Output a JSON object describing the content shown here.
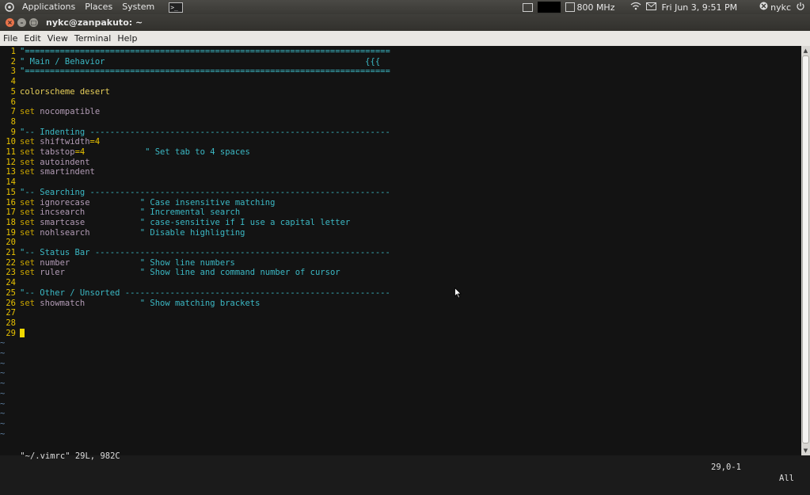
{
  "panel": {
    "menus": [
      "Applications",
      "Places",
      "System"
    ],
    "cpu_freq": "800 MHz",
    "datetime": "Fri Jun  3,  9:51 PM",
    "user": "nykc"
  },
  "window": {
    "title": "nykc@zanpakuto: ~"
  },
  "menubar": [
    "File",
    "Edit",
    "View",
    "Terminal",
    "Help"
  ],
  "editor": {
    "lines": [
      {
        "n": "1",
        "segs": [
          {
            "t": "\"=========================================================================",
            "c": "c-cmt"
          }
        ]
      },
      {
        "n": "2",
        "segs": [
          {
            "t": "\" Main / Behavior                                                    {{{",
            "c": "c-cmt"
          }
        ]
      },
      {
        "n": "3",
        "segs": [
          {
            "t": "\"=========================================================================",
            "c": "c-cmt"
          }
        ]
      },
      {
        "n": "4",
        "segs": []
      },
      {
        "n": "5",
        "segs": [
          {
            "t": "colorscheme desert",
            "c": "c-kw2"
          }
        ]
      },
      {
        "n": "6",
        "segs": []
      },
      {
        "n": "7",
        "segs": [
          {
            "t": "set ",
            "c": "c-kw"
          },
          {
            "t": "nocompatible",
            "c": "c-opt"
          }
        ]
      },
      {
        "n": "8",
        "segs": []
      },
      {
        "n": "9",
        "segs": [
          {
            "t": "\"-- Indenting ------------------------------------------------------------",
            "c": "c-cmt"
          }
        ]
      },
      {
        "n": "10",
        "segs": [
          {
            "t": "set ",
            "c": "c-kw"
          },
          {
            "t": "shiftwidth",
            "c": "c-opt"
          },
          {
            "t": "=4",
            "c": "c-val"
          }
        ]
      },
      {
        "n": "11",
        "segs": [
          {
            "t": "set ",
            "c": "c-kw"
          },
          {
            "t": "tabstop",
            "c": "c-opt"
          },
          {
            "t": "=4            ",
            "c": "c-val"
          },
          {
            "t": "\" Set tab to 4 spaces",
            "c": "c-cmt"
          }
        ]
      },
      {
        "n": "12",
        "segs": [
          {
            "t": "set ",
            "c": "c-kw"
          },
          {
            "t": "autoindent",
            "c": "c-opt"
          }
        ]
      },
      {
        "n": "13",
        "segs": [
          {
            "t": "set ",
            "c": "c-kw"
          },
          {
            "t": "smartindent",
            "c": "c-opt"
          }
        ]
      },
      {
        "n": "14",
        "segs": []
      },
      {
        "n": "15",
        "segs": [
          {
            "t": "\"-- Searching ------------------------------------------------------------",
            "c": "c-cmt"
          }
        ]
      },
      {
        "n": "16",
        "segs": [
          {
            "t": "set ",
            "c": "c-kw"
          },
          {
            "t": "ignorecase          ",
            "c": "c-opt"
          },
          {
            "t": "\" Case insensitive matching",
            "c": "c-cmt"
          }
        ]
      },
      {
        "n": "17",
        "segs": [
          {
            "t": "set ",
            "c": "c-kw"
          },
          {
            "t": "incsearch           ",
            "c": "c-opt"
          },
          {
            "t": "\" Incremental search",
            "c": "c-cmt"
          }
        ]
      },
      {
        "n": "18",
        "segs": [
          {
            "t": "set ",
            "c": "c-kw"
          },
          {
            "t": "smartcase           ",
            "c": "c-opt"
          },
          {
            "t": "\" case-sensitive if I use a capital letter",
            "c": "c-cmt"
          }
        ]
      },
      {
        "n": "19",
        "segs": [
          {
            "t": "set ",
            "c": "c-kw"
          },
          {
            "t": "nohlsearch          ",
            "c": "c-opt"
          },
          {
            "t": "\" Disable highligting",
            "c": "c-cmt"
          }
        ]
      },
      {
        "n": "20",
        "segs": []
      },
      {
        "n": "21",
        "segs": [
          {
            "t": "\"-- Status Bar -----------------------------------------------------------",
            "c": "c-cmt"
          }
        ]
      },
      {
        "n": "22",
        "segs": [
          {
            "t": "set ",
            "c": "c-kw"
          },
          {
            "t": "number              ",
            "c": "c-opt"
          },
          {
            "t": "\" Show line numbers",
            "c": "c-cmt"
          }
        ]
      },
      {
        "n": "23",
        "segs": [
          {
            "t": "set ",
            "c": "c-kw"
          },
          {
            "t": "ruler               ",
            "c": "c-opt"
          },
          {
            "t": "\" Show line and command number of cursor",
            "c": "c-cmt"
          }
        ]
      },
      {
        "n": "24",
        "segs": []
      },
      {
        "n": "25",
        "segs": [
          {
            "t": "\"-- Other / Unsorted -----------------------------------------------------",
            "c": "c-cmt"
          }
        ]
      },
      {
        "n": "26",
        "segs": [
          {
            "t": "set ",
            "c": "c-kw"
          },
          {
            "t": "showmatch           ",
            "c": "c-opt"
          },
          {
            "t": "\" Show matching brackets",
            "c": "c-cmt"
          }
        ]
      },
      {
        "n": "27",
        "segs": []
      },
      {
        "n": "28",
        "segs": []
      },
      {
        "n": "29",
        "segs": [],
        "cursor": true
      }
    ],
    "tilde_count": 10,
    "tilde_char": "~",
    "status_left": "\"~/.vimrc\" 29L, 982C",
    "status_pos": "29,0-1",
    "status_scroll": "All"
  },
  "colors": {
    "line_number": "#e8c100",
    "comment": "#3bb8c4",
    "keyword": "#c9a400",
    "option": "#b29bb5",
    "cursor": "#f0d800",
    "terminal_bg": "#131313"
  }
}
